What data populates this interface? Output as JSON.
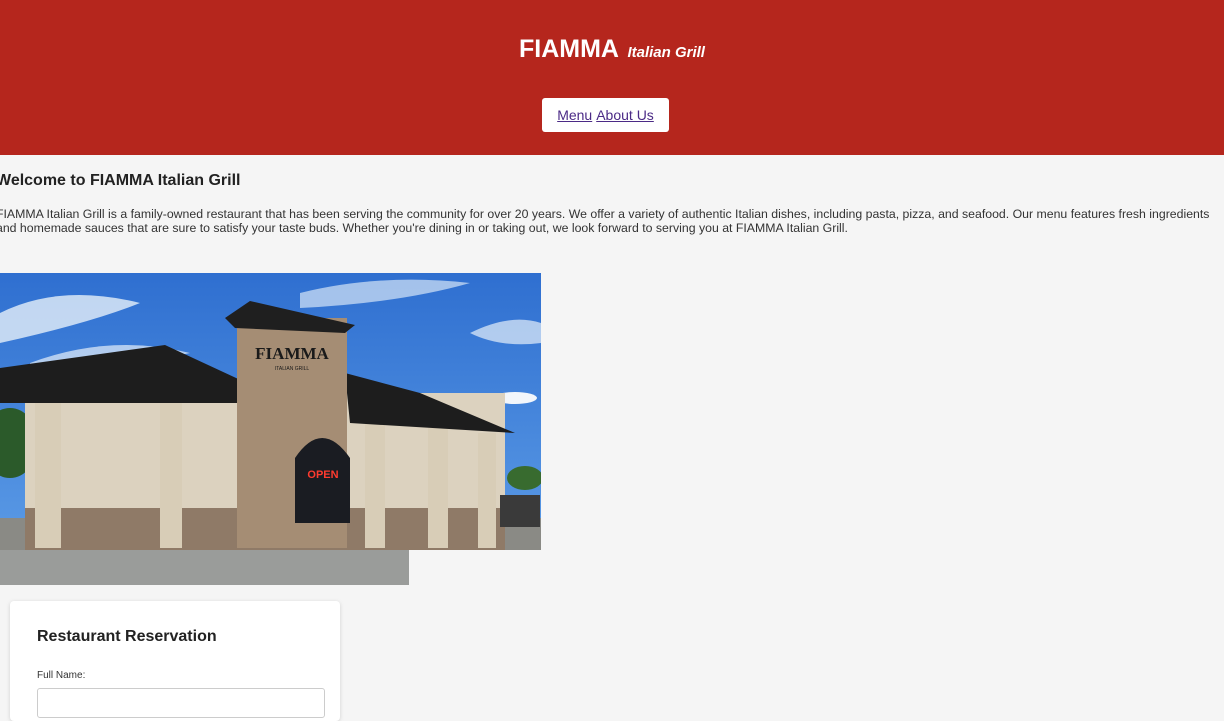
{
  "header": {
    "brand_name": "FIAMMA",
    "brand_tagline": "Italian Grill",
    "nav": [
      {
        "label": "Menu"
      },
      {
        "label": "About Us"
      }
    ],
    "background_color": "#b5261d"
  },
  "welcome": {
    "title": "Welcome to FIAMMA Italian Grill",
    "text": "FIAMMA Italian Grill is a family-owned restaurant that has been serving the community for over 20 years. We offer a variety of authentic Italian dishes, including pasta, pizza, and seafood. Our menu features fresh ingredients and homemade sauces that are sure to satisfy your taste buds. Whether you're dining in or taking out, we look forward to serving you at FIAMMA Italian Grill."
  },
  "photo": {
    "sign_text": "FIAMMA",
    "sign_subtext": "ITALIAN GRILL",
    "open_sign": "OPEN"
  },
  "reservation": {
    "title": "Restaurant Reservation",
    "full_name_label": "Full Name:",
    "full_name_value": ""
  }
}
